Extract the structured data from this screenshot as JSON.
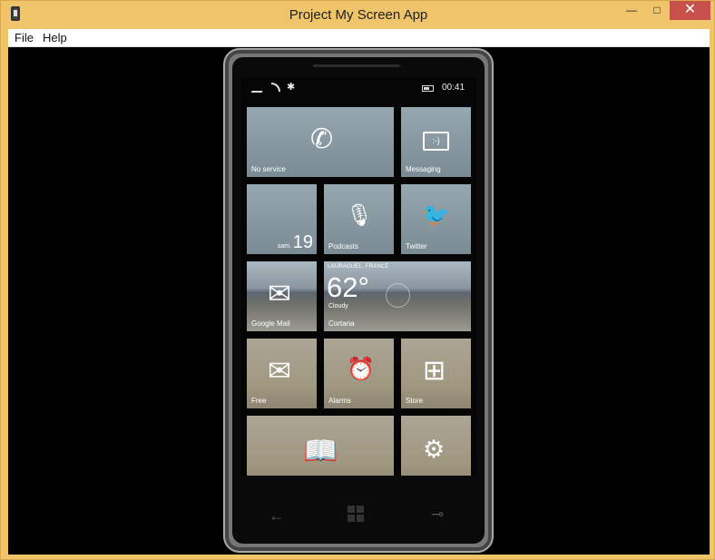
{
  "window": {
    "title": "Project My Screen App",
    "controls": {
      "minimize": "—",
      "maximize": "□",
      "close": "✕"
    }
  },
  "menu": {
    "file": "File",
    "help": "Help"
  },
  "phone": {
    "status": {
      "bluetooth_symbol": "✱",
      "time": "00:41"
    },
    "tiles": [
      {
        "id": "phone",
        "label": "No service",
        "icon": "phone-icon",
        "glyph": "✆"
      },
      {
        "id": "messaging",
        "label": "Messaging",
        "icon": "chat-icon",
        "glyph": ":-)"
      },
      {
        "id": "calendar",
        "label": "",
        "day": "sam.",
        "number": "19"
      },
      {
        "id": "podcasts",
        "label": "Podcasts",
        "icon": "microphone-icon",
        "glyph": "🎙"
      },
      {
        "id": "twitter",
        "label": "Twitter",
        "icon": "bird-icon",
        "glyph": "🐦"
      },
      {
        "id": "google-mail",
        "label": "Google Mail",
        "icon": "mail-icon",
        "glyph": "✉"
      },
      {
        "id": "cortana",
        "label": "Cortana",
        "location": "LAURAGUEL, FRANCE",
        "temperature": "62°",
        "condition": "Cloudy"
      },
      {
        "id": "free",
        "label": "Free",
        "icon": "mail-icon",
        "glyph": "✉"
      },
      {
        "id": "alarms",
        "label": "Alarms",
        "icon": "clock-icon",
        "glyph": "⏰"
      },
      {
        "id": "store",
        "label": "Store",
        "icon": "bag-icon",
        "glyph": "⊞"
      },
      {
        "id": "reader",
        "label": "",
        "icon": "book-icon",
        "glyph": "📖"
      },
      {
        "id": "settings",
        "label": "",
        "icon": "gear-icon",
        "glyph": "⚙"
      }
    ],
    "nav": {
      "back": "←",
      "search": "⊸"
    }
  },
  "colors": {
    "title_bar": "#efc46a",
    "close_button": "#c7504b",
    "screen_background": "#000000"
  }
}
